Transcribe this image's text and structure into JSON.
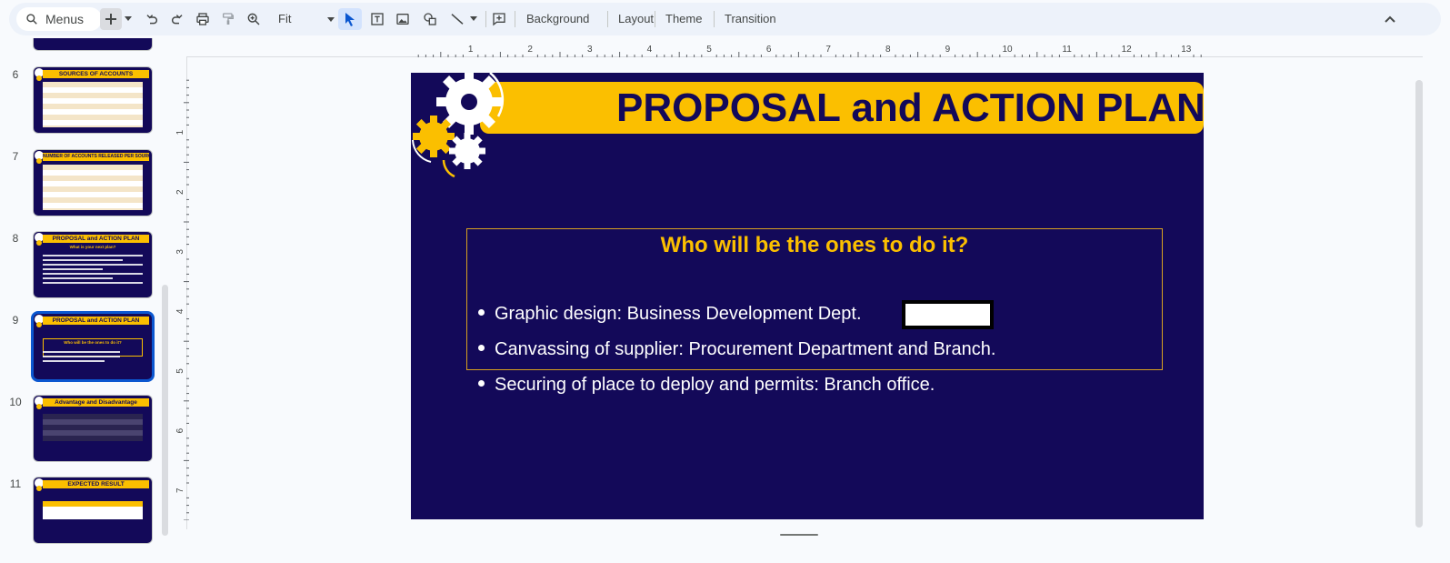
{
  "toolbar": {
    "menus_label": "Menus",
    "zoom_value": "Fit",
    "background_label": "Background",
    "layout_label": "Layout",
    "theme_label": "Theme",
    "transition_label": "Transition"
  },
  "filmstrip": {
    "slides": [
      {
        "number": "6",
        "title": "SOURCES OF ACCOUNTS"
      },
      {
        "number": "7",
        "title": "NUMBER OF ACCOUNTS RELEASED PER SOURCE"
      },
      {
        "number": "8",
        "title": "PROPOSAL and ACTION PLAN",
        "subtitle": "What is your next plan?"
      },
      {
        "number": "9",
        "title": "PROPOSAL and ACTION PLAN",
        "subtitle": "Who will be the ones to do it?"
      },
      {
        "number": "10",
        "title": "Advantage and Disadvantage"
      },
      {
        "number": "11",
        "title": "EXPECTED RESULT"
      }
    ]
  },
  "ruler": {
    "top_ticks": [
      "1",
      "2",
      "3",
      "4",
      "5",
      "6",
      "7",
      "8",
      "9",
      "10",
      "11",
      "12",
      "13"
    ],
    "left_ticks": [
      "1",
      "2",
      "3",
      "4",
      "5",
      "6",
      "7"
    ]
  },
  "slide": {
    "title": "PROPOSAL and ACTION PLAN",
    "subtitle": "Who will be the ones to do it?",
    "bullets": [
      "Graphic design: Business Development Dept.",
      "Canvassing of supplier: Procurement Department and Branch.",
      "Securing of place to deploy and permits: Branch office."
    ]
  },
  "colors": {
    "slide_background": "#130959",
    "accent_yellow": "#fbbf00",
    "selection_blue": "#0b57d0"
  }
}
